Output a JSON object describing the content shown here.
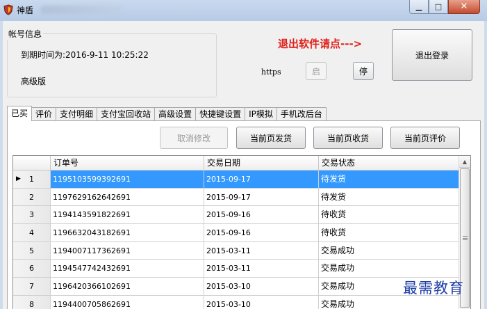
{
  "window": {
    "title": "神盾",
    "controls": {
      "minimize_glyph": "▁",
      "maximize_glyph": "□",
      "close_glyph": "✕"
    }
  },
  "account_group": {
    "legend": "帐号信息",
    "expiry": "到期时间为:2016-9-11 10:25:22",
    "edition": "高级版"
  },
  "exit_hint": "退出软件请点--->",
  "https_label": "https",
  "start_button": "启",
  "stop_button": "停",
  "logout_button": "退出登录",
  "tabs": [
    "已买",
    "评价",
    "支付明细",
    "支付宝回收站",
    "高级设置",
    "快捷键设置",
    "IP模拟",
    "手机改后台"
  ],
  "actions": {
    "cancel_edit": "取消修改",
    "ship_page": "当前页发货",
    "receive_page": "当前页收货",
    "review_page": "当前页评价"
  },
  "grid": {
    "columns": [
      "订单号",
      "交易日期",
      "交易状态"
    ],
    "rows": [
      {
        "num": "1",
        "order": "1195103599392691",
        "date": "2015-09-17",
        "status": "待发货"
      },
      {
        "num": "2",
        "order": "1197629162642691",
        "date": "2015-09-17",
        "status": "待发货"
      },
      {
        "num": "3",
        "order": "1194143591822691",
        "date": "2015-09-16",
        "status": "待收货"
      },
      {
        "num": "4",
        "order": "1196632043182691",
        "date": "2015-09-16",
        "status": "待收货"
      },
      {
        "num": "5",
        "order": "1194007117362691",
        "date": "2015-03-11",
        "status": "交易成功"
      },
      {
        "num": "6",
        "order": "1194547742432691",
        "date": "2015-03-11",
        "status": "交易成功"
      },
      {
        "num": "7",
        "order": "1196420366102691",
        "date": "2015-03-10",
        "status": "交易成功"
      },
      {
        "num": "8",
        "order": "1194400705862691",
        "date": "2015-03-10",
        "status": "交易成功"
      }
    ],
    "selected_row_marker": "▶",
    "scroll_up_glyph": "▲"
  },
  "watermark": "最需教育",
  "colors": {
    "selection": "#3399ff",
    "hint_red": "#e0201a",
    "watermark_blue": "#1e3fa8"
  }
}
